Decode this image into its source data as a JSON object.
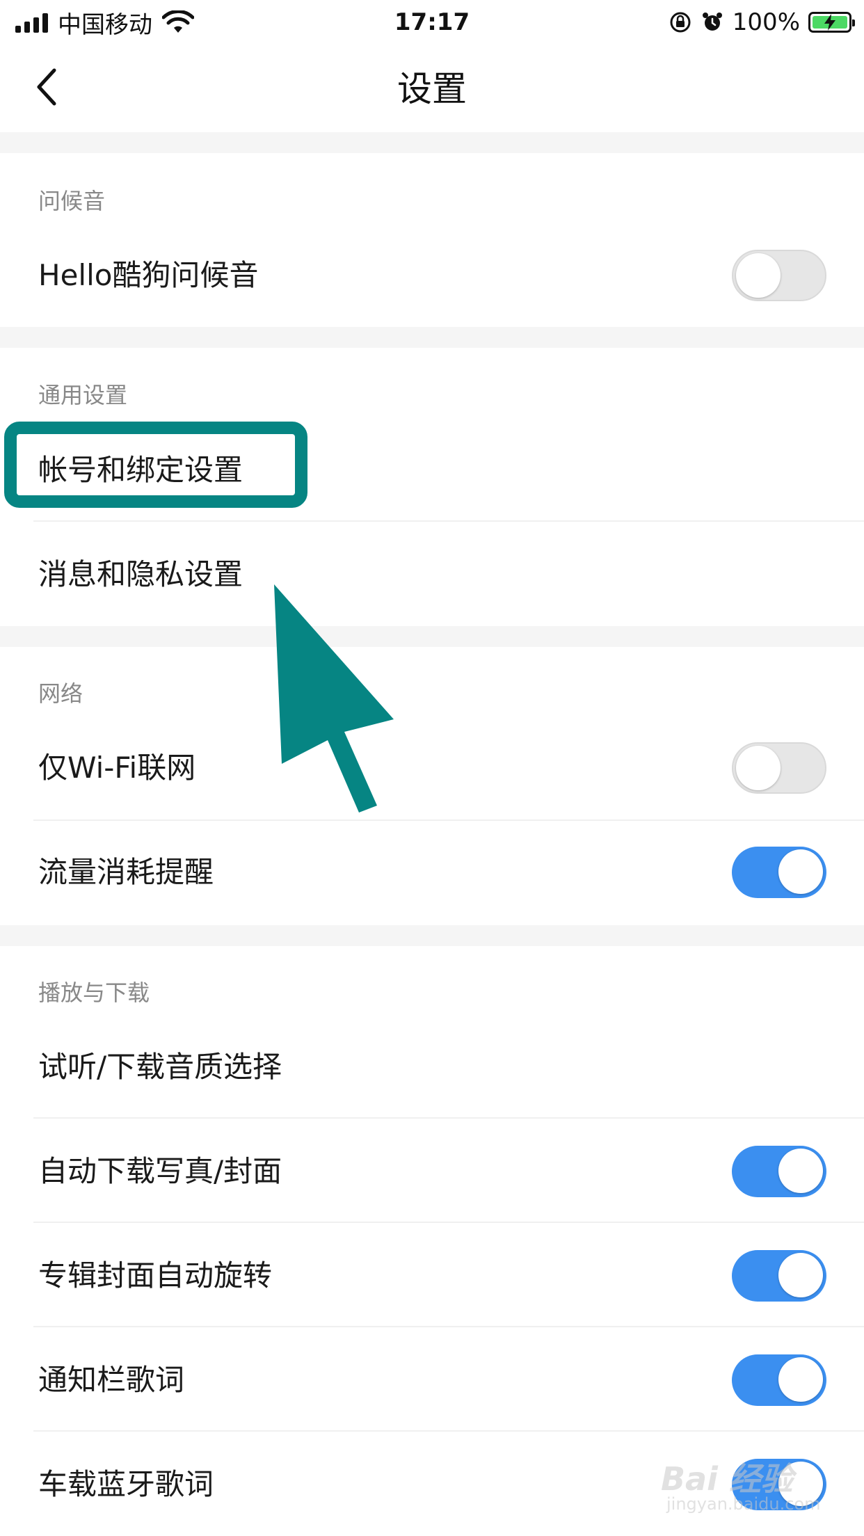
{
  "status_bar": {
    "carrier": "中国移动",
    "time": "17:17",
    "battery_percent": "100%",
    "battery_level": 1.0,
    "icons": [
      "signal-icon",
      "wifi-icon",
      "rotation-lock-icon",
      "alarm-icon",
      "battery-charging-icon"
    ]
  },
  "nav": {
    "title": "设置",
    "back_icon": "chevron-left-icon"
  },
  "sections": {
    "greeting": {
      "header": "问候音",
      "hello": {
        "label": "Hello酷狗问候音",
        "toggle_on": false
      }
    },
    "general": {
      "header": "通用设置",
      "account": {
        "label": "帐号和绑定设置"
      },
      "privacy": {
        "label": "消息和隐私设置"
      }
    },
    "network": {
      "header": "网络",
      "wifi_only": {
        "label": "仅Wi-Fi联网",
        "toggle_on": false
      },
      "data_alert": {
        "label": "流量消耗提醒",
        "toggle_on": true
      }
    },
    "playback": {
      "header": "播放与下载",
      "quality": {
        "label": "试听/下载音质选择"
      },
      "auto_download": {
        "label": "自动下载写真/封面",
        "toggle_on": true
      },
      "rotate_cover": {
        "label": "专辑封面自动旋转",
        "toggle_on": true
      },
      "notif_lyrics": {
        "label": "通知栏歌词",
        "toggle_on": true
      },
      "car_lyrics": {
        "label": "车载蓝牙歌词",
        "toggle_on": true
      }
    }
  },
  "annotation": {
    "highlight_color": "#068583",
    "arrow_color": "#068583"
  },
  "colors": {
    "toggle_on": "#3b8ff0",
    "toggle_off": "#e6e6e6",
    "section_gap": "#f5f5f5"
  }
}
